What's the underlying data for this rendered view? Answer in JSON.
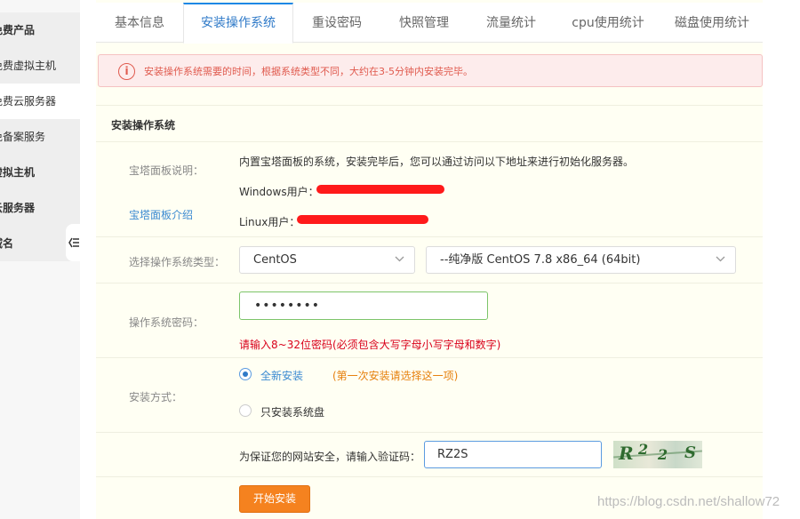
{
  "sidebar": {
    "items": [
      {
        "label": "免费产品"
      },
      {
        "label": "免费虚拟主机"
      },
      {
        "label": "免费云服务器"
      },
      {
        "label": "免备案服务"
      },
      {
        "label": "虚拟主机"
      },
      {
        "label": "云服务器"
      },
      {
        "label": "域名"
      }
    ]
  },
  "tabs": [
    {
      "label": "基本信息"
    },
    {
      "label": "安装操作系统"
    },
    {
      "label": "重设密码"
    },
    {
      "label": "快照管理"
    },
    {
      "label": "流量统计"
    },
    {
      "label": "cpu使用统计"
    },
    {
      "label": "磁盘使用统计"
    }
  ],
  "alert": {
    "icon": "info-icon",
    "text": "安装操作系统需要的时间，根据系统类型不同，大约在3-5分钟内安装完毕。",
    "color": "#e05a4e"
  },
  "section": {
    "title": "安装操作系统"
  },
  "panel": {
    "label": "宝塔面板说明：",
    "intro_link": "宝塔面板介绍",
    "description": "内置宝塔面板的系统，安装完毕后，您可以通过访问以下地址来进行初始化服务器。",
    "windows_label": "Windows用户：",
    "linux_label": "Linux用户："
  },
  "os_type": {
    "label": "选择操作系统类型：",
    "selected": "CentOS",
    "version_selected": "--纯净版 CentOS 7.8  x86_64 (64bit)"
  },
  "password": {
    "label": "操作系统密码：",
    "value": "••••••••",
    "error": "请输入8~32位密码(必须包含大写字母小写字母和数字)"
  },
  "install_mode": {
    "label": "安装方式：",
    "options": [
      {
        "label": "全新安装",
        "hint": "(第一次安装请选择这一项)",
        "selected": true
      },
      {
        "label": "只安装系统盘",
        "selected": false
      }
    ]
  },
  "captcha": {
    "label": "为保证您的网站安全，请输入验证码：",
    "value": "RZ2S",
    "image_text": [
      "R",
      "2",
      "2",
      "S"
    ]
  },
  "submit": {
    "label": "开始安装",
    "color": "#f5821f"
  },
  "watermark": "https://blog.csdn.net/shallow72"
}
